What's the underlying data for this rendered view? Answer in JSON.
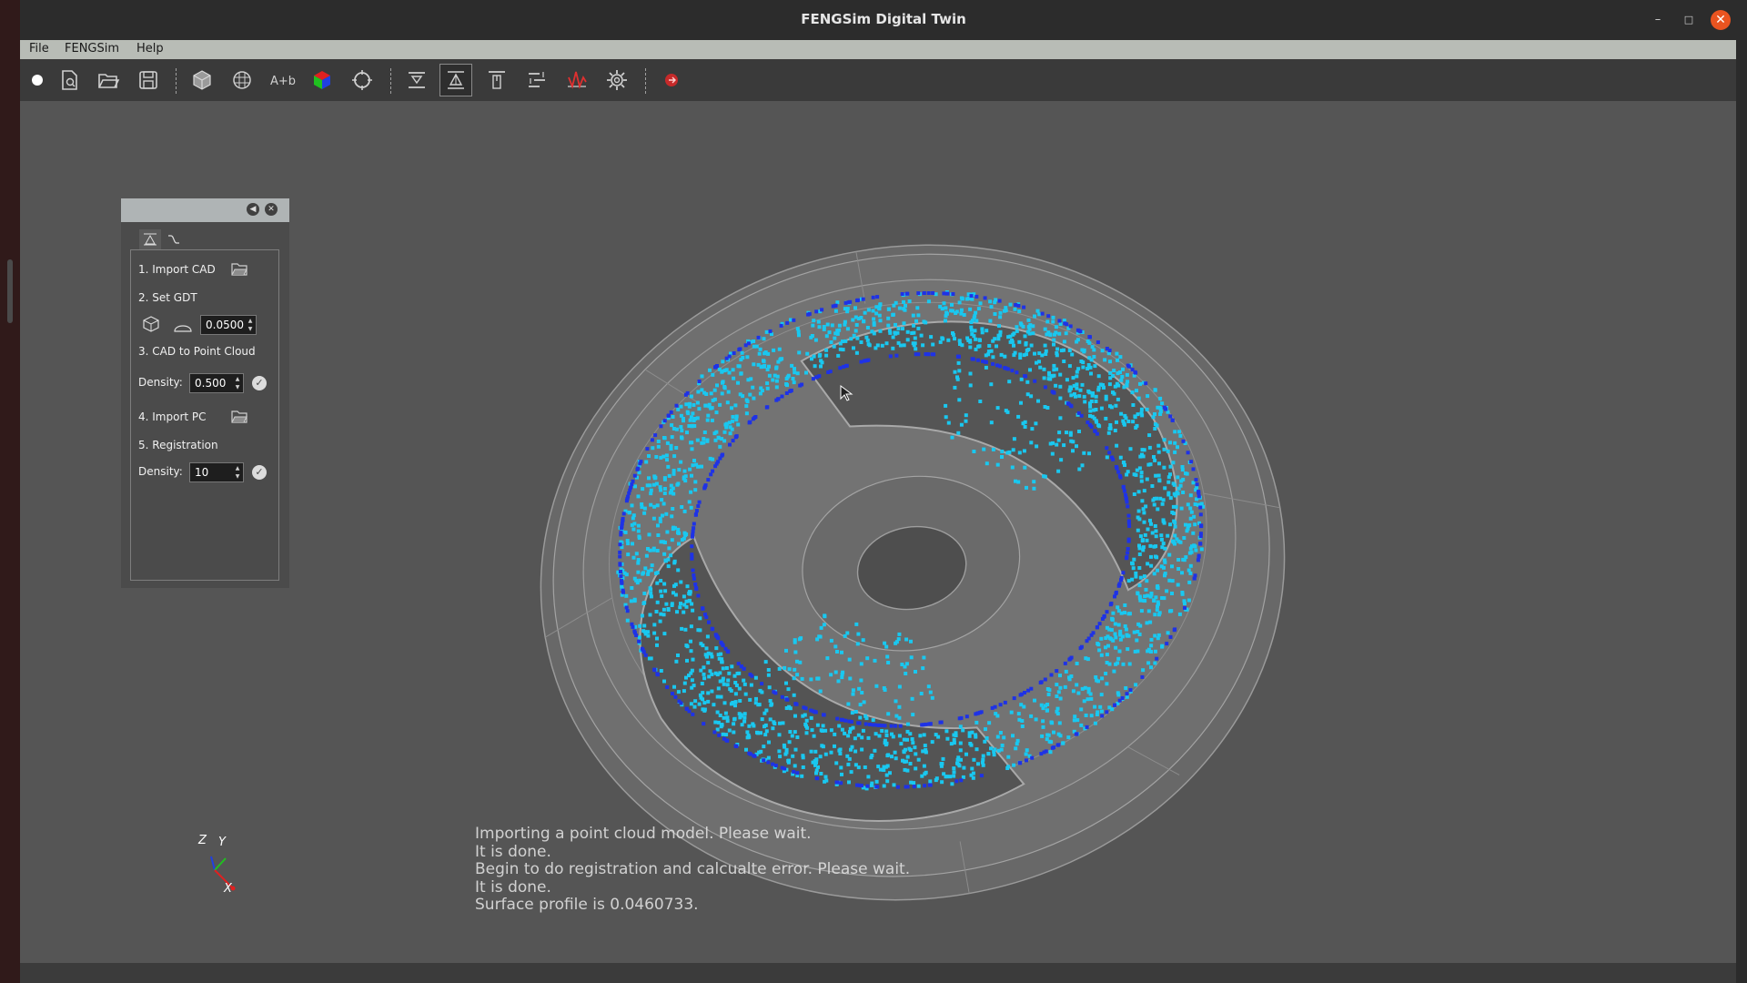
{
  "window": {
    "title": "FENGSim Digital Twin"
  },
  "menu": [
    {
      "label": "File"
    },
    {
      "label": "FENGSim"
    },
    {
      "label": "Help"
    }
  ],
  "toolbar": {
    "icons": [
      "record-icon",
      "new-file-icon",
      "open-folder-icon",
      "save-icon",
      "cube-icon",
      "mesh-icon",
      "text-label-icon",
      "color-cube-icon",
      "circle-select-icon",
      "section-top-icon",
      "measure-icon",
      "align-top-icon",
      "distribute-icon",
      "waveform-icon",
      "settings-gear-icon",
      "exit-icon"
    ]
  },
  "panel": {
    "step1": "1. Import CAD",
    "step2": "2. Set GDT",
    "gdt_value": "0.0500",
    "step3": "3. CAD to Point Cloud",
    "density_label": "Density:",
    "density1": "0.500",
    "step4": "4. Import PC",
    "step5": "5. Registration",
    "density2": "10"
  },
  "log": [
    "Importing a point cloud model. Please wait.",
    "It is done.",
    "Begin to do registration and calcualte error. Please wait.",
    "It is done.",
    "Surface profile is 0.0460733."
  ],
  "axes": {
    "z": "Z",
    "y": "Y",
    "x": "X"
  },
  "colors": {
    "viewport_bg": "#555555",
    "point_cyan": "#19c8f0",
    "point_blue": "#1e32e6",
    "close_orange": "#e95420"
  }
}
